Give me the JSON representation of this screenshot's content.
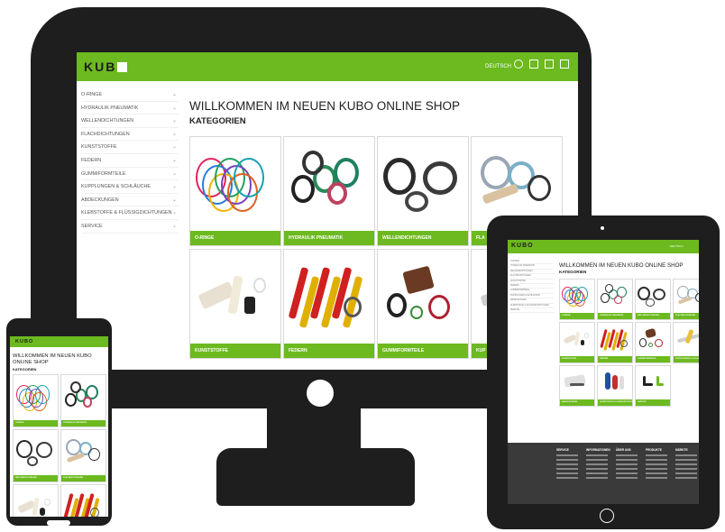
{
  "brand": {
    "logo": "KUBO",
    "accent": "#6cba1f",
    "dark": "#1e1e1e"
  },
  "header": {
    "language": "DEUTSCH",
    "icons": [
      "search-icon",
      "user-icon",
      "document-icon",
      "cart-icon"
    ]
  },
  "sidebar": {
    "items": [
      {
        "label": "O-RINGE"
      },
      {
        "label": "HYDRAULIK PNEUMATIK"
      },
      {
        "label": "WELLENDICHTUNGEN"
      },
      {
        "label": "FLACHDICHTUNGEN"
      },
      {
        "label": "KUNSTSTOFFE"
      },
      {
        "label": "FEDERN"
      },
      {
        "label": "GUMMIFORMTEILE"
      },
      {
        "label": "KUPPLUNGEN & SCHLÄUCHE"
      },
      {
        "label": "ABDECKUNGEN"
      },
      {
        "label": "KLEBSTOFFE & FLÜSSIGDICHTUNGEN"
      },
      {
        "label": "SERVICE"
      }
    ]
  },
  "main": {
    "title": "WILLKOMMEN IM NEUEN KUBO ONLINE SHOP",
    "subtitle": "KATEGORIEN",
    "categories": [
      {
        "label": "O-RINGE",
        "art": "orings"
      },
      {
        "label": "HYDRAULIK PNEUMATIK",
        "art": "hydraulik"
      },
      {
        "label": "WELLENDICHTUNGEN",
        "art": "wellen"
      },
      {
        "label": "FLACHDICHTUNGEN",
        "art": "flach"
      },
      {
        "label": "KUNSTSTOFFE",
        "art": "kunst"
      },
      {
        "label": "FEDERN",
        "art": "federn"
      },
      {
        "label": "GUMMIFORMTEILE",
        "art": "gummi"
      },
      {
        "label": "KUPPLUNGEN & SCHLÄUCHE",
        "art": "kupplung"
      }
    ],
    "desktop_tile_labels": [
      "O-RINGE",
      "HYDRAULIK PNEUMATIK",
      "WELLENDICHTUNGEN",
      "FLA",
      "KUNSTSTOFFE",
      "FEDERN",
      "GUMMIFORMTEILE",
      "KUP"
    ]
  },
  "tablet": {
    "extra_categories": [
      {
        "label": "ABDECKUNGEN",
        "art": "abdeck"
      },
      {
        "label": "KLEBSTOFFE & FLÜSSIGDICHTUNGEN",
        "art": "kleb"
      },
      {
        "label": "SERVICE",
        "art": "service"
      }
    ],
    "footer_columns": [
      "SERVICE",
      "INFORMATIONEN",
      "ÜBER UNS",
      "PRODUKTE",
      "MÄRKTE"
    ]
  },
  "phone": {
    "title": "WILLKOMMEN IM NEUEN KUBO ONLINE SHOP",
    "subtitle": "KATEGORIEN"
  }
}
